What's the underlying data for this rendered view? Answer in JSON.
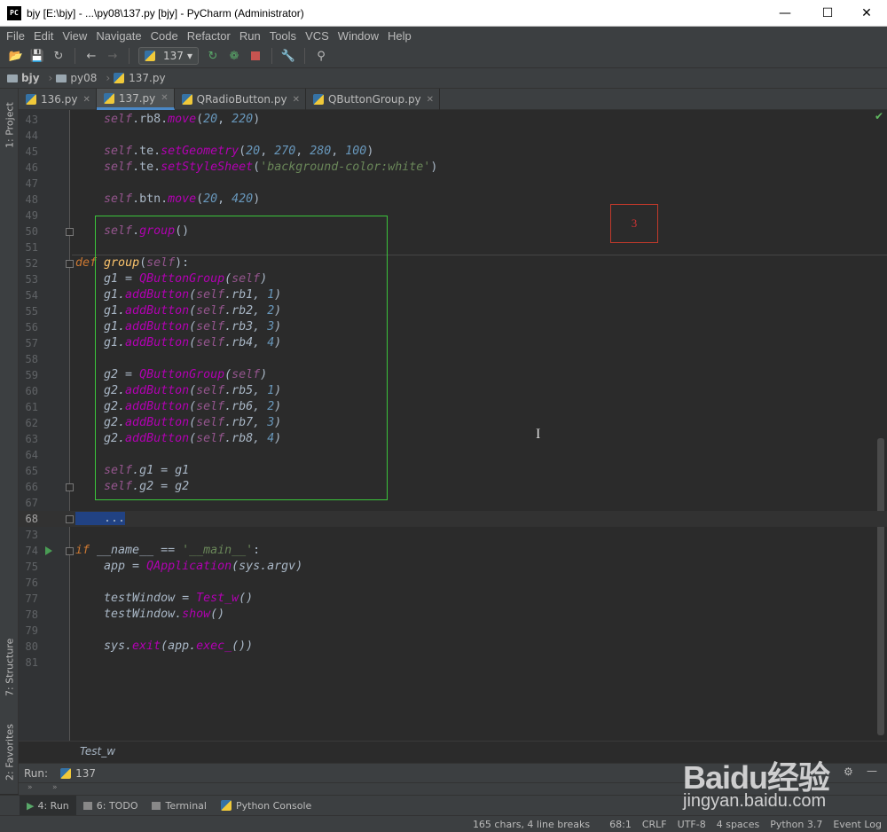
{
  "window": {
    "icon_text": "PC",
    "title": "bjy [E:\\bjy] - ...\\py08\\137.py [bjy] - PyCharm (Administrator)"
  },
  "menu": [
    "File",
    "Edit",
    "View",
    "Navigate",
    "Code",
    "Refactor",
    "Run",
    "Tools",
    "VCS",
    "Window",
    "Help"
  ],
  "toolbar": {
    "run_config": "137"
  },
  "breadcrumb": [
    "bjy",
    "py08",
    "137.py"
  ],
  "tabs": [
    {
      "label": "136.py"
    },
    {
      "label": "137.py"
    },
    {
      "label": "QRadioButton.py"
    },
    {
      "label": "QButtonGroup.py"
    }
  ],
  "left_strip": {
    "project": "1: Project",
    "structure": "7: Structure",
    "favorites": "2: Favorites"
  },
  "lines": [
    "43",
    "44",
    "45",
    "46",
    "47",
    "48",
    "49",
    "50",
    "51",
    "52",
    "53",
    "54",
    "55",
    "56",
    "57",
    "58",
    "59",
    "60",
    "61",
    "62",
    "63",
    "64",
    "65",
    "66",
    "67",
    "68",
    "73",
    "74",
    "75",
    "76",
    "77",
    "78",
    "79",
    "80",
    "81"
  ],
  "annotation_number": "3",
  "editor_breadcrumb": "Test_w",
  "run": {
    "label": "Run:",
    "config": "137"
  },
  "tool_windows": [
    {
      "label": "4: Run"
    },
    {
      "label": "6: TODO"
    },
    {
      "label": "Terminal"
    },
    {
      "label": "Python Console"
    }
  ],
  "status": {
    "selection": "165 chars, 4 line breaks",
    "position": "68:1",
    "line_sep": "CRLF",
    "encoding": "UTF-8",
    "indent": "4 spaces",
    "interpreter": "Python 3.7",
    "event_log": "Event Log"
  },
  "watermark": {
    "main": "Baidu经验",
    "sub": "jingyan.baidu.com"
  }
}
